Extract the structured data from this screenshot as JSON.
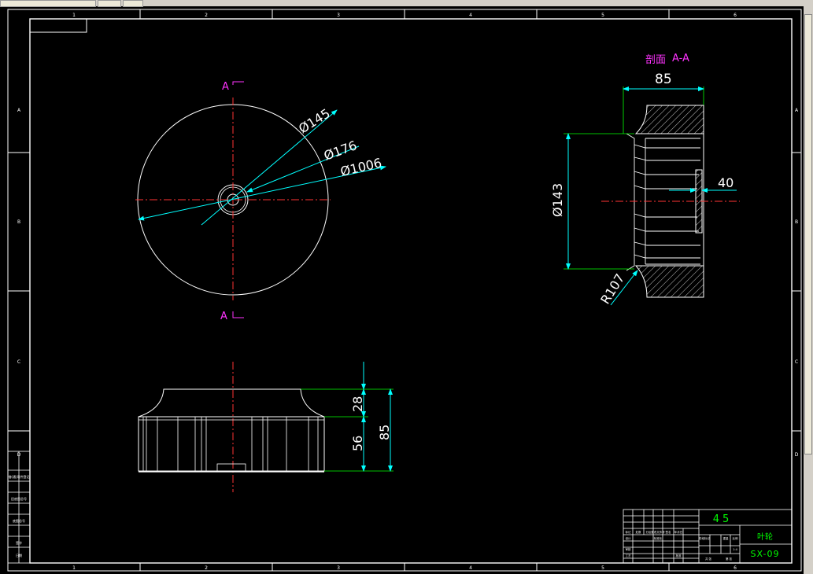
{
  "colors": {
    "background": "#000000",
    "outline": "#ffffff",
    "dimension": "#00ffff",
    "centerline": "#ff3333",
    "section_label": "#ff33ff",
    "dim_extension": "#00ff00",
    "title_text": "#00ff00",
    "frame": "#ffffff"
  },
  "frame": {
    "column_numbers": [
      "1",
      "2",
      "3",
      "4",
      "5",
      "6"
    ],
    "row_letters": [
      "A",
      "B",
      "C",
      "D"
    ]
  },
  "front_view": {
    "section_mark_top": "A",
    "section_mark_bottom": "A",
    "dims": {
      "d145": "Ø145",
      "d176": "Ø176",
      "d1006": "Ø1006"
    }
  },
  "section_view": {
    "title_cn": "剖面",
    "title_id": "A-A",
    "dims": {
      "width": "85",
      "dia": "Ø143",
      "thk": "40",
      "radius": "R107"
    }
  },
  "side_view": {
    "dims": {
      "top_h": "28",
      "bottom_h": "56",
      "total_h": "85"
    }
  },
  "title_block": {
    "material": "45",
    "part_name": "叶轮",
    "drawing_no": "SX-09",
    "small_cells": [
      "标记",
      "处数",
      "分区",
      "更改文件号",
      "签名",
      "年月日",
      "设计",
      "标准化",
      "阶段标记",
      "重量",
      "比例",
      "审核",
      "工艺",
      "批准",
      "共 张",
      "第 张",
      "1:4"
    ]
  },
  "left_table": {
    "labels": [
      "借(通)用件登记",
      "旧底图总号",
      "底图总号",
      "签字",
      "日期"
    ]
  }
}
